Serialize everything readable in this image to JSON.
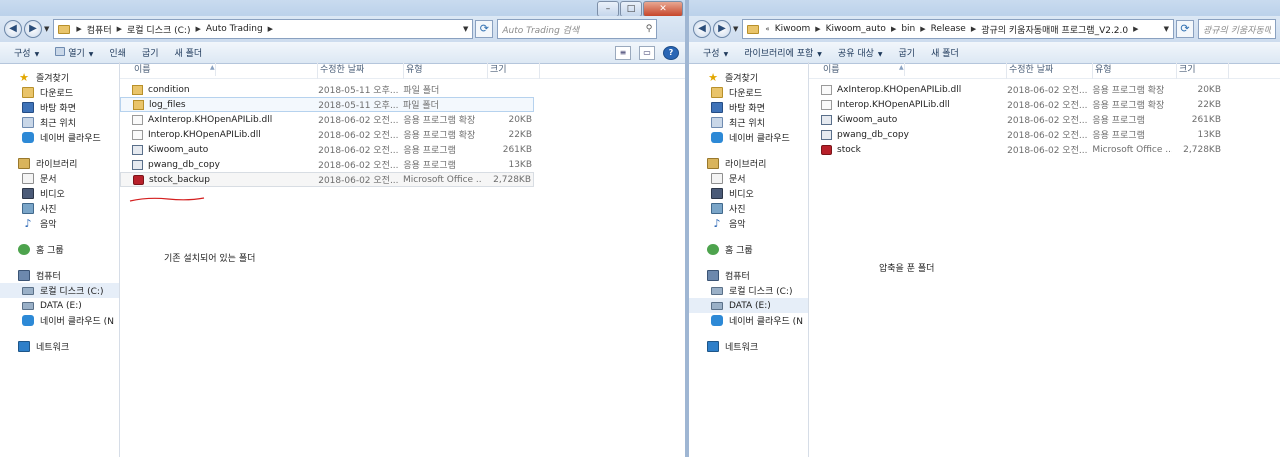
{
  "left": {
    "address": {
      "crumbs": [
        "컴퓨터",
        "로컬 디스크 (C:)",
        "Auto Trading"
      ]
    },
    "search_placeholder": "Auto Trading 검색",
    "toolbar": {
      "organize": "구성",
      "open": "열기",
      "print": "인쇄",
      "burn": "굽기",
      "new_folder": "새 폴더"
    },
    "columns": {
      "name": "이름",
      "date": "수정한 날짜",
      "type": "유형",
      "size": "크기"
    },
    "files": [
      {
        "name": "condition",
        "date": "2018-05-11 오후...",
        "type": "파일 폴더",
        "size": "",
        "icon": "folder-icon"
      },
      {
        "name": "log_files",
        "date": "2018-05-11 오후...",
        "type": "파일 폴더",
        "size": "",
        "icon": "folder-icon"
      },
      {
        "name": "AxInterop.KHOpenAPILib.dll",
        "date": "2018-06-02 오전...",
        "type": "응용 프로그램 확장",
        "size": "20KB",
        "icon": "dll-icon"
      },
      {
        "name": "Interop.KHOpenAPILib.dll",
        "date": "2018-06-02 오전...",
        "type": "응용 프로그램 확장",
        "size": "22KB",
        "icon": "dll-icon"
      },
      {
        "name": "Kiwoom_auto",
        "date": "2018-06-02 오전...",
        "type": "응용 프로그램",
        "size": "261KB",
        "icon": "application-icon"
      },
      {
        "name": "pwang_db_copy",
        "date": "2018-06-02 오전...",
        "type": "응용 프로그램",
        "size": "13KB",
        "icon": "application-icon"
      },
      {
        "name": "stock_backup",
        "date": "2018-06-02 오전...",
        "type": "Microsoft Office ...",
        "size": "2,728KB",
        "icon": "access-database-icon"
      }
    ],
    "note": "기존 설치되어 있는 폴더",
    "nav": {
      "favorites": "즐겨찾기",
      "downloads": "다운로드",
      "desktop": "바탕 화면",
      "recent": "최근 위치",
      "naver_cloud": "네이버 클라우드",
      "libraries": "라이브러리",
      "documents": "문서",
      "videos": "비디오",
      "pictures": "사진",
      "music": "음악",
      "homegroup": "홈 그룹",
      "computer": "컴퓨터",
      "local_disk": "로컬 디스크 (C:)",
      "data_drive": "DATA (E:)",
      "naver_cloud_drive": "네이버 클라우드 (N",
      "network": "네트워크"
    }
  },
  "right": {
    "address": {
      "crumbs": [
        "Kiwoom",
        "Kiwoom_auto",
        "bin",
        "Release",
        "광규의 키움자동매매 프로그램_V2.2.0"
      ]
    },
    "search_placeholder": "광규의 키움자동매",
    "toolbar": {
      "organize": "구성",
      "include_library": "라이브러리에 포함",
      "share": "공유 대상",
      "burn": "굽기",
      "new_folder": "새 폴더"
    },
    "columns": {
      "name": "이름",
      "date": "수정한 날짜",
      "type": "유형",
      "size": "크기"
    },
    "files": [
      {
        "name": "AxInterop.KHOpenAPILib.dll",
        "date": "2018-06-02 오전...",
        "type": "응용 프로그램 확장",
        "size": "20KB",
        "icon": "dll-icon"
      },
      {
        "name": "Interop.KHOpenAPILib.dll",
        "date": "2018-06-02 오전...",
        "type": "응용 프로그램 확장",
        "size": "22KB",
        "icon": "dll-icon"
      },
      {
        "name": "Kiwoom_auto",
        "date": "2018-06-02 오전...",
        "type": "응용 프로그램",
        "size": "261KB",
        "icon": "application-icon"
      },
      {
        "name": "pwang_db_copy",
        "date": "2018-06-02 오전...",
        "type": "응용 프로그램",
        "size": "13KB",
        "icon": "application-icon"
      },
      {
        "name": "stock",
        "date": "2018-06-02 오전...",
        "type": "Microsoft Office ...",
        "size": "2,728KB",
        "icon": "access-database-icon"
      }
    ],
    "note": "압축을 푼 폴더",
    "nav": {
      "favorites": "즐겨찾기",
      "downloads": "다운로드",
      "desktop": "바탕 화면",
      "recent": "최근 위치",
      "naver_cloud": "네이버 클라우드",
      "libraries": "라이브러리",
      "documents": "문서",
      "videos": "비디오",
      "pictures": "사진",
      "music": "음악",
      "homegroup": "홈 그룹",
      "computer": "컴퓨터",
      "local_disk": "로컬 디스크 (C:)",
      "data_drive": "DATA (E:)",
      "naver_cloud_drive": "네이버 클라우드 (N",
      "network": "네트워크"
    }
  },
  "annotation_color": "#d42020"
}
